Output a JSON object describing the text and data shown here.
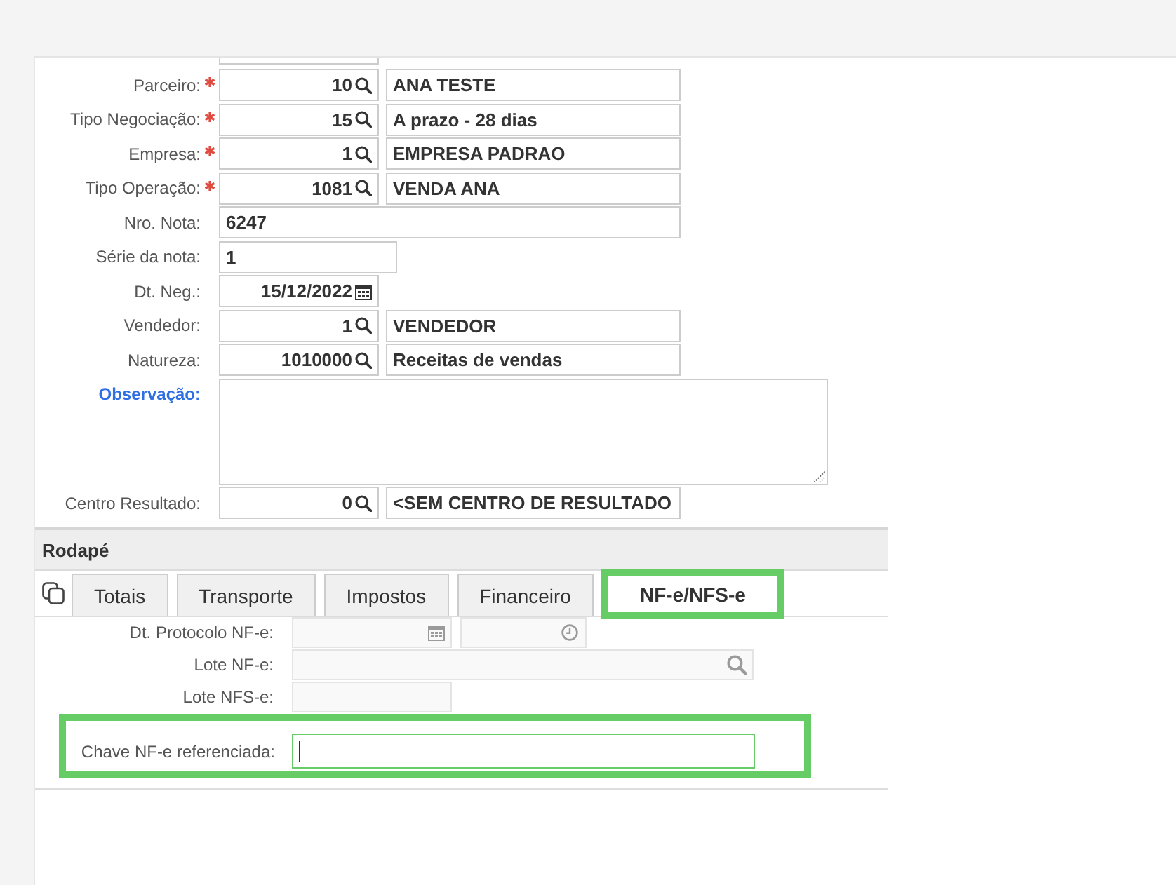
{
  "form": {
    "fields": [
      {
        "kind": "lookup",
        "label": "Parceiro:",
        "required": true,
        "link": false,
        "code": "10",
        "description": "ANA TESTE"
      },
      {
        "kind": "lookup",
        "label": "Tipo Negociação:",
        "required": true,
        "link": false,
        "code": "15",
        "description": "A prazo - 28 dias"
      },
      {
        "kind": "lookup",
        "label": "Empresa:",
        "required": true,
        "link": false,
        "code": "1",
        "description": "EMPRESA PADRAO"
      },
      {
        "kind": "lookup",
        "label": "Tipo Operação:",
        "required": true,
        "link": false,
        "code": "1081",
        "description": "VENDA ANA"
      },
      {
        "kind": "text",
        "label": "Nro. Nota:",
        "required": false,
        "link": false,
        "value": "6247"
      },
      {
        "kind": "short",
        "label": "Série da nota:",
        "required": false,
        "link": false,
        "value": "1"
      },
      {
        "kind": "date",
        "label": "Dt. Neg.:",
        "required": false,
        "link": false,
        "value": "15/12/2022"
      },
      {
        "kind": "lookup",
        "label": "Vendedor:",
        "required": false,
        "link": false,
        "code": "1",
        "description": "VENDEDOR"
      },
      {
        "kind": "lookup",
        "label": "Natureza:",
        "required": false,
        "link": false,
        "code": "1010000",
        "description": "Receitas de vendas"
      },
      {
        "kind": "textarea",
        "label": "Observação:",
        "required": false,
        "link": true
      },
      {
        "kind": "lookup",
        "label": "Centro Resultado:",
        "required": false,
        "link": false,
        "code": "0",
        "description": "<SEM CENTRO DE RESULTADO"
      }
    ]
  },
  "footer": {
    "title": "Rodapé",
    "tabs": [
      {
        "label": "Totais",
        "selected": false,
        "highlighted": false
      },
      {
        "label": "Transporte",
        "selected": false,
        "highlighted": false
      },
      {
        "label": "Impostos",
        "selected": false,
        "highlighted": false
      },
      {
        "label": "Financeiro",
        "selected": false,
        "highlighted": false
      },
      {
        "label": "NF-e/NFS-e",
        "selected": true,
        "highlighted": true
      }
    ],
    "fields": [
      {
        "kind": "datetime",
        "label": "Dt. Protocolo NF-e:",
        "disabled": true,
        "focused": false,
        "highlighted": false
      },
      {
        "kind": "lookup",
        "label": "Lote NF-e:",
        "disabled": true,
        "focused": false,
        "highlighted": false
      },
      {
        "kind": "short",
        "label": "Lote NFS-e:",
        "disabled": true,
        "focused": false,
        "highlighted": false
      },
      {
        "kind": "text",
        "label": "Chave NF-e referenciada:",
        "disabled": false,
        "focused": true,
        "highlighted": true
      }
    ]
  }
}
